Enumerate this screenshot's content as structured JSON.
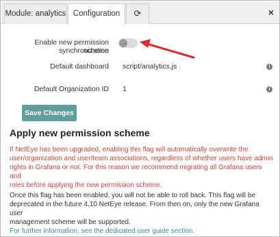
{
  "tabs": [
    {
      "label": "Module: analytics"
    },
    {
      "label": "Configuration"
    },
    {
      "label": "⟳"
    }
  ],
  "close_label": "×",
  "settings": {
    "sync_label_line1": "Enable new permission scheme",
    "sync_label_line2": "synchronization",
    "sync_enabled": false,
    "dashboard_label": "Default dashboard",
    "dashboard_value": "script/analytics.js",
    "org_label": "Default Organization ID",
    "org_value": "1"
  },
  "save_label": "Save Changes",
  "section": {
    "heading": "Apply new permission scheme",
    "warning_lines": [
      "If NetEye has been upgraded, enabling this flag will automatically overwrite the",
      "user/organization and user/team associations, regardless of whether users have admin",
      "rights in Grafana or not. For this reason we recommend migrating all Grafana users and",
      "roles before applying the new permission scheme."
    ],
    "note_lines": [
      "Once this flag has been enabled, you will not be able to roll back. This flag will be",
      "deprecated in the future 4.10 NetEye release. From then on, only the new Grafana user",
      "management scheme will be supported."
    ],
    "link_text": "For further information, see the dedicated user guide section."
  },
  "icons": {
    "refresh": "refresh-icon",
    "close": "close-icon",
    "info": "info-icon",
    "annotation": "red-arrow"
  },
  "colors": {
    "button": "#5e9e9b",
    "warning": "#e0403c",
    "link": "#3d8f8b",
    "arrow": "#e3262b"
  }
}
